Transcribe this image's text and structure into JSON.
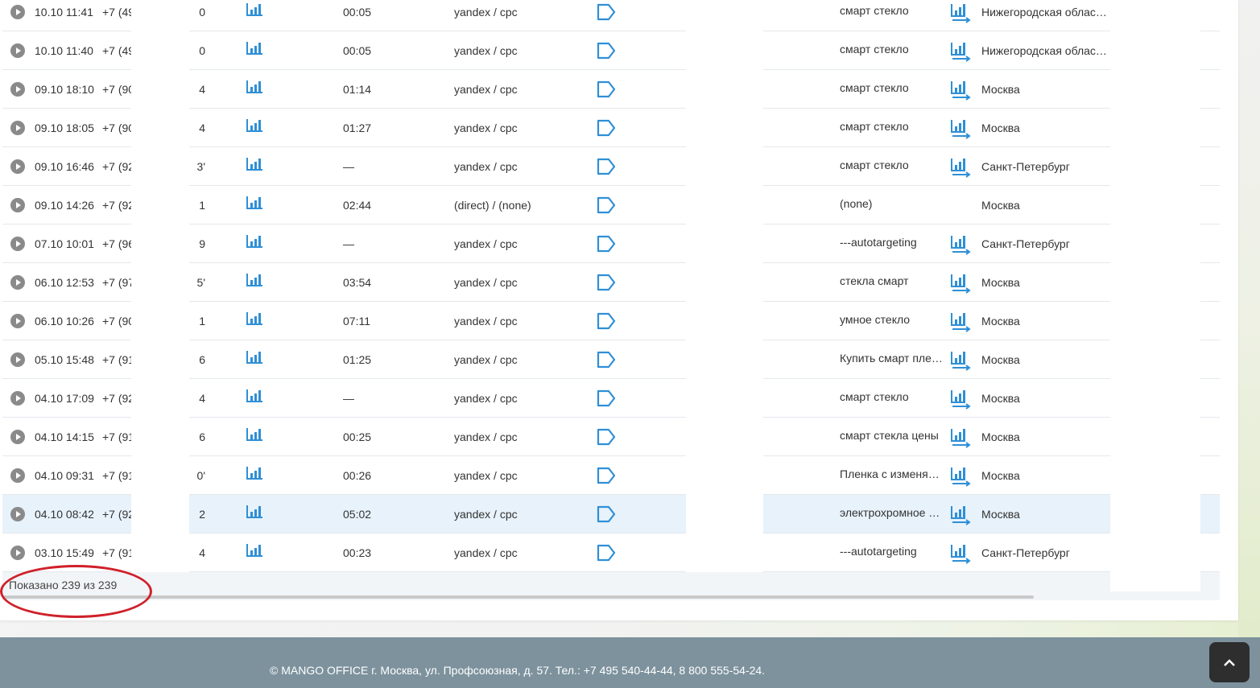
{
  "rows": [
    {
      "date": "10.10 11:41",
      "phone": "+7 (49",
      "num": "0",
      "duration": "00:05",
      "source": "yandex / cpc",
      "keyword": "смарт стекло",
      "region": "Нижегородская облас…",
      "has_arrow": true
    },
    {
      "date": "10.10 11:40",
      "phone": "+7 (49",
      "num": "0",
      "duration": "00:05",
      "source": "yandex / cpc",
      "keyword": "смарт стекло",
      "region": "Нижегородская облас…",
      "has_arrow": true
    },
    {
      "date": "09.10 18:10",
      "phone": "+7 (90",
      "num": "4",
      "duration": "01:14",
      "source": "yandex / cpc",
      "keyword": "смарт стекло",
      "region": "Москва",
      "has_arrow": true
    },
    {
      "date": "09.10 18:05",
      "phone": "+7 (90",
      "num": "4",
      "duration": "01:27",
      "source": "yandex / cpc",
      "keyword": "смарт стекло",
      "region": "Москва",
      "has_arrow": true
    },
    {
      "date": "09.10 16:46",
      "phone": "+7 (92",
      "num": "'3",
      "duration": "—",
      "source": "yandex / cpc",
      "keyword": "смарт стекло",
      "region": "Санкт-Петербург",
      "has_arrow": true
    },
    {
      "date": "09.10 14:26",
      "phone": "+7 (92",
      "num": "1",
      "duration": "02:44",
      "source": "(direct) / (none)",
      "keyword": "(none)",
      "region": "Москва",
      "has_arrow": false
    },
    {
      "date": "07.10 10:01",
      "phone": "+7 (96",
      "num": "9",
      "duration": "—",
      "source": "yandex / cpc",
      "keyword": "---autotargeting",
      "region": "Санкт-Петербург",
      "has_arrow": true
    },
    {
      "date": "06.10 12:53",
      "phone": "+7 (97",
      "num": "'5",
      "duration": "03:54",
      "source": "yandex / cpc",
      "keyword": "стекла смарт",
      "region": "Москва",
      "has_arrow": true
    },
    {
      "date": "06.10 10:26",
      "phone": "+7 (90",
      "num": "1",
      "duration": "07:11",
      "source": "yandex / cpc",
      "keyword": "умное стекло",
      "region": "Москва",
      "has_arrow": true
    },
    {
      "date": "05.10 15:48",
      "phone": "+7 (91",
      "num": "6",
      "duration": "01:25",
      "source": "yandex / cpc",
      "keyword": "Купить смарт пле…",
      "region": "Москва",
      "has_arrow": true
    },
    {
      "date": "04.10 17:09",
      "phone": "+7 (92",
      "num": "4",
      "duration": "—",
      "source": "yandex / cpc",
      "keyword": "смарт стекло",
      "region": "Москва",
      "has_arrow": true
    },
    {
      "date": "04.10 14:15",
      "phone": "+7 (91",
      "num": "6",
      "duration": "00:25",
      "source": "yandex / cpc",
      "keyword": "смарт стекла цены",
      "region": "Москва",
      "has_arrow": true
    },
    {
      "date": "04.10 09:31",
      "phone": "+7 (91",
      "num": "'0",
      "duration": "00:26",
      "source": "yandex / cpc",
      "keyword": "Пленка с изменя…",
      "region": "Москва",
      "has_arrow": true
    },
    {
      "date": "04.10 08:42",
      "phone": "+7 (92",
      "num": "2",
      "duration": "05:02",
      "source": "yandex / cpc",
      "keyword": "электрохромное …",
      "region": "Москва",
      "has_arrow": true,
      "highlighted": true
    },
    {
      "date": "03.10 15:49",
      "phone": "+7 (91",
      "num": "4",
      "duration": "00:23",
      "source": "yandex / cpc",
      "keyword": "---autotargeting",
      "region": "Санкт-Петербург",
      "has_arrow": true
    }
  ],
  "table_footer": {
    "shown_label": "Показано 239 из 239"
  },
  "site_footer": {
    "copyright": "© MANGO OFFICE г. Москва, ул. Профсоюзная, д. 57. Тел.: +7 495 540-44-44, 8 800 555-54-24."
  },
  "icons": {
    "play": "play-icon",
    "bars": "signal-bars-icon",
    "tag": "tag-icon",
    "arrow": "chart-arrow-icon",
    "up": "chevron-up-icon"
  },
  "colors": {
    "accent": "#2f8fd6",
    "highlight_row": "#e7f2fb",
    "annotation": "#d0202a",
    "footer_bg": "#7d929d"
  }
}
